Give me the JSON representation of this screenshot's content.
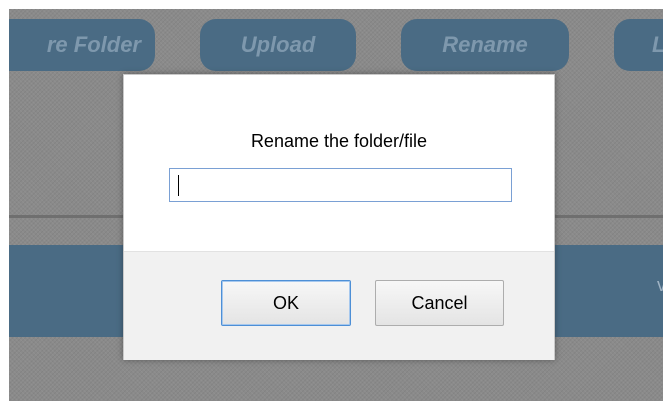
{
  "toolbar": {
    "new_folder_label": "re Folder",
    "upload_label": "Upload",
    "rename_label": "Rename",
    "last_label": "L",
    "accent_color": "#4a6b84"
  },
  "table_header": {
    "edge_glyph": "v"
  },
  "dialog": {
    "title": "Rename the folder/file",
    "input_value": "",
    "ok_label": "OK",
    "cancel_label": "Cancel",
    "focus_color": "#4d8fd6"
  }
}
